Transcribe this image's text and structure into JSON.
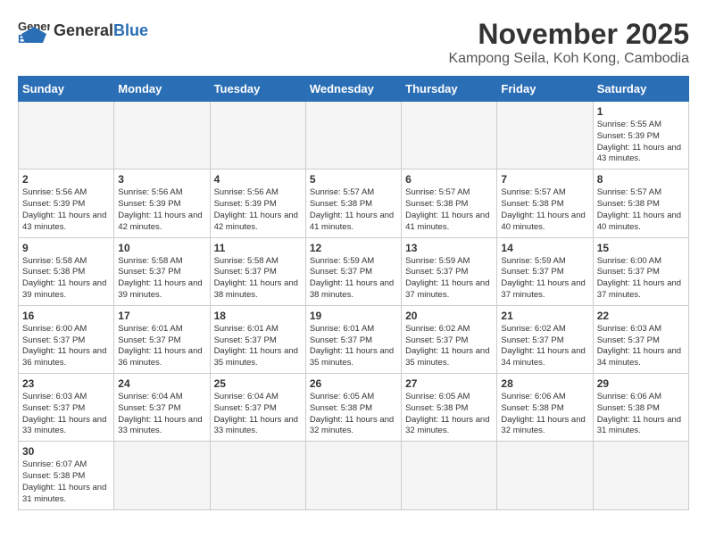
{
  "header": {
    "logo_general": "General",
    "logo_blue": "Blue",
    "month_title": "November 2025",
    "subtitle": "Kampong Seila, Koh Kong, Cambodia"
  },
  "days_of_week": [
    "Sunday",
    "Monday",
    "Tuesday",
    "Wednesday",
    "Thursday",
    "Friday",
    "Saturday"
  ],
  "weeks": [
    [
      {
        "day": "",
        "info": ""
      },
      {
        "day": "",
        "info": ""
      },
      {
        "day": "",
        "info": ""
      },
      {
        "day": "",
        "info": ""
      },
      {
        "day": "",
        "info": ""
      },
      {
        "day": "",
        "info": ""
      },
      {
        "day": "1",
        "info": "Sunrise: 5:55 AM\nSunset: 5:39 PM\nDaylight: 11 hours\nand 43 minutes."
      }
    ],
    [
      {
        "day": "2",
        "info": "Sunrise: 5:56 AM\nSunset: 5:39 PM\nDaylight: 11 hours\nand 43 minutes."
      },
      {
        "day": "3",
        "info": "Sunrise: 5:56 AM\nSunset: 5:39 PM\nDaylight: 11 hours\nand 42 minutes."
      },
      {
        "day": "4",
        "info": "Sunrise: 5:56 AM\nSunset: 5:39 PM\nDaylight: 11 hours\nand 42 minutes."
      },
      {
        "day": "5",
        "info": "Sunrise: 5:57 AM\nSunset: 5:38 PM\nDaylight: 11 hours\nand 41 minutes."
      },
      {
        "day": "6",
        "info": "Sunrise: 5:57 AM\nSunset: 5:38 PM\nDaylight: 11 hours\nand 41 minutes."
      },
      {
        "day": "7",
        "info": "Sunrise: 5:57 AM\nSunset: 5:38 PM\nDaylight: 11 hours\nand 40 minutes."
      },
      {
        "day": "8",
        "info": "Sunrise: 5:57 AM\nSunset: 5:38 PM\nDaylight: 11 hours\nand 40 minutes."
      }
    ],
    [
      {
        "day": "9",
        "info": "Sunrise: 5:58 AM\nSunset: 5:38 PM\nDaylight: 11 hours\nand 39 minutes."
      },
      {
        "day": "10",
        "info": "Sunrise: 5:58 AM\nSunset: 5:37 PM\nDaylight: 11 hours\nand 39 minutes."
      },
      {
        "day": "11",
        "info": "Sunrise: 5:58 AM\nSunset: 5:37 PM\nDaylight: 11 hours\nand 38 minutes."
      },
      {
        "day": "12",
        "info": "Sunrise: 5:59 AM\nSunset: 5:37 PM\nDaylight: 11 hours\nand 38 minutes."
      },
      {
        "day": "13",
        "info": "Sunrise: 5:59 AM\nSunset: 5:37 PM\nDaylight: 11 hours\nand 37 minutes."
      },
      {
        "day": "14",
        "info": "Sunrise: 5:59 AM\nSunset: 5:37 PM\nDaylight: 11 hours\nand 37 minutes."
      },
      {
        "day": "15",
        "info": "Sunrise: 6:00 AM\nSunset: 5:37 PM\nDaylight: 11 hours\nand 37 minutes."
      }
    ],
    [
      {
        "day": "16",
        "info": "Sunrise: 6:00 AM\nSunset: 5:37 PM\nDaylight: 11 hours\nand 36 minutes."
      },
      {
        "day": "17",
        "info": "Sunrise: 6:01 AM\nSunset: 5:37 PM\nDaylight: 11 hours\nand 36 minutes."
      },
      {
        "day": "18",
        "info": "Sunrise: 6:01 AM\nSunset: 5:37 PM\nDaylight: 11 hours\nand 35 minutes."
      },
      {
        "day": "19",
        "info": "Sunrise: 6:01 AM\nSunset: 5:37 PM\nDaylight: 11 hours\nand 35 minutes."
      },
      {
        "day": "20",
        "info": "Sunrise: 6:02 AM\nSunset: 5:37 PM\nDaylight: 11 hours\nand 35 minutes."
      },
      {
        "day": "21",
        "info": "Sunrise: 6:02 AM\nSunset: 5:37 PM\nDaylight: 11 hours\nand 34 minutes."
      },
      {
        "day": "22",
        "info": "Sunrise: 6:03 AM\nSunset: 5:37 PM\nDaylight: 11 hours\nand 34 minutes."
      }
    ],
    [
      {
        "day": "23",
        "info": "Sunrise: 6:03 AM\nSunset: 5:37 PM\nDaylight: 11 hours\nand 33 minutes."
      },
      {
        "day": "24",
        "info": "Sunrise: 6:04 AM\nSunset: 5:37 PM\nDaylight: 11 hours\nand 33 minutes."
      },
      {
        "day": "25",
        "info": "Sunrise: 6:04 AM\nSunset: 5:37 PM\nDaylight: 11 hours\nand 33 minutes."
      },
      {
        "day": "26",
        "info": "Sunrise: 6:05 AM\nSunset: 5:38 PM\nDaylight: 11 hours\nand 32 minutes."
      },
      {
        "day": "27",
        "info": "Sunrise: 6:05 AM\nSunset: 5:38 PM\nDaylight: 11 hours\nand 32 minutes."
      },
      {
        "day": "28",
        "info": "Sunrise: 6:06 AM\nSunset: 5:38 PM\nDaylight: 11 hours\nand 32 minutes."
      },
      {
        "day": "29",
        "info": "Sunrise: 6:06 AM\nSunset: 5:38 PM\nDaylight: 11 hours\nand 31 minutes."
      }
    ],
    [
      {
        "day": "30",
        "info": "Sunrise: 6:07 AM\nSunset: 5:38 PM\nDaylight: 11 hours\nand 31 minutes."
      },
      {
        "day": "",
        "info": ""
      },
      {
        "day": "",
        "info": ""
      },
      {
        "day": "",
        "info": ""
      },
      {
        "day": "",
        "info": ""
      },
      {
        "day": "",
        "info": ""
      },
      {
        "day": "",
        "info": ""
      }
    ]
  ]
}
